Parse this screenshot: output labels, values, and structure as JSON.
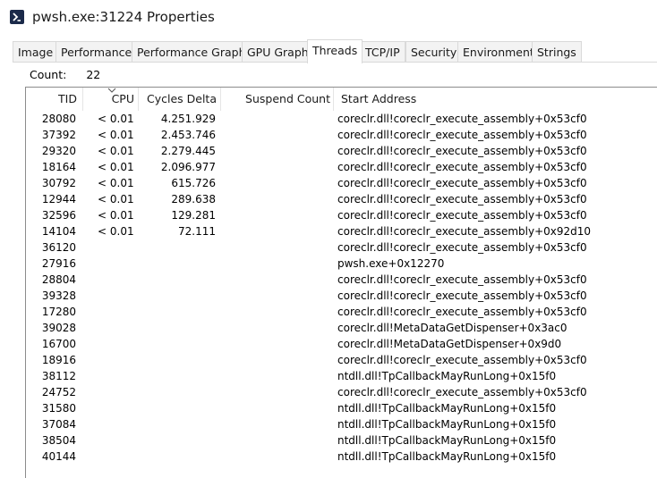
{
  "window": {
    "title": "pwsh.exe:31224 Properties",
    "icon": "powershell-icon"
  },
  "tabs": [
    {
      "label": "Image",
      "active": false
    },
    {
      "label": "Performance",
      "active": false
    },
    {
      "label": "Performance Graph",
      "active": false
    },
    {
      "label": "GPU Graph",
      "active": false
    },
    {
      "label": "Threads",
      "active": true
    },
    {
      "label": "TCP/IP",
      "active": false
    },
    {
      "label": "Security",
      "active": false
    },
    {
      "label": "Environment",
      "active": false
    },
    {
      "label": "Strings",
      "active": false
    }
  ],
  "count": {
    "label": "Count:",
    "value": "22"
  },
  "columns": {
    "tid": "TID",
    "cpu": "CPU",
    "cycles": "Cycles Delta",
    "suspend": "Suspend Count",
    "address": "Start Address"
  },
  "sort_icon": "chevron-down-icon",
  "threads": [
    {
      "tid": "28080",
      "cpu": "< 0.01",
      "cycles": "4.251.929",
      "suspend": "",
      "address": "coreclr.dll!coreclr_execute_assembly+0x53cf0"
    },
    {
      "tid": "37392",
      "cpu": "< 0.01",
      "cycles": "2.453.746",
      "suspend": "",
      "address": "coreclr.dll!coreclr_execute_assembly+0x53cf0"
    },
    {
      "tid": "29320",
      "cpu": "< 0.01",
      "cycles": "2.279.445",
      "suspend": "",
      "address": "coreclr.dll!coreclr_execute_assembly+0x53cf0"
    },
    {
      "tid": "18164",
      "cpu": "< 0.01",
      "cycles": "2.096.977",
      "suspend": "",
      "address": "coreclr.dll!coreclr_execute_assembly+0x53cf0"
    },
    {
      "tid": "30792",
      "cpu": "< 0.01",
      "cycles": "615.726",
      "suspend": "",
      "address": "coreclr.dll!coreclr_execute_assembly+0x53cf0"
    },
    {
      "tid": "12944",
      "cpu": "< 0.01",
      "cycles": "289.638",
      "suspend": "",
      "address": "coreclr.dll!coreclr_execute_assembly+0x53cf0"
    },
    {
      "tid": "32596",
      "cpu": "< 0.01",
      "cycles": "129.281",
      "suspend": "",
      "address": "coreclr.dll!coreclr_execute_assembly+0x53cf0"
    },
    {
      "tid": "14104",
      "cpu": "< 0.01",
      "cycles": "72.111",
      "suspend": "",
      "address": "coreclr.dll!coreclr_execute_assembly+0x92d10"
    },
    {
      "tid": "36120",
      "cpu": "",
      "cycles": "",
      "suspend": "",
      "address": "coreclr.dll!coreclr_execute_assembly+0x53cf0"
    },
    {
      "tid": "27916",
      "cpu": "",
      "cycles": "",
      "suspend": "",
      "address": "pwsh.exe+0x12270"
    },
    {
      "tid": "28804",
      "cpu": "",
      "cycles": "",
      "suspend": "",
      "address": "coreclr.dll!coreclr_execute_assembly+0x53cf0"
    },
    {
      "tid": "39328",
      "cpu": "",
      "cycles": "",
      "suspend": "",
      "address": "coreclr.dll!coreclr_execute_assembly+0x53cf0"
    },
    {
      "tid": "17280",
      "cpu": "",
      "cycles": "",
      "suspend": "",
      "address": "coreclr.dll!coreclr_execute_assembly+0x53cf0"
    },
    {
      "tid": "39028",
      "cpu": "",
      "cycles": "",
      "suspend": "",
      "address": "coreclr.dll!MetaDataGetDispenser+0x3ac0"
    },
    {
      "tid": "16700",
      "cpu": "",
      "cycles": "",
      "suspend": "",
      "address": "coreclr.dll!MetaDataGetDispenser+0x9d0"
    },
    {
      "tid": "18916",
      "cpu": "",
      "cycles": "",
      "suspend": "",
      "address": "coreclr.dll!coreclr_execute_assembly+0x53cf0"
    },
    {
      "tid": "38112",
      "cpu": "",
      "cycles": "",
      "suspend": "",
      "address": "ntdll.dll!TpCallbackMayRunLong+0x15f0"
    },
    {
      "tid": "24752",
      "cpu": "",
      "cycles": "",
      "suspend": "",
      "address": "coreclr.dll!coreclr_execute_assembly+0x53cf0"
    },
    {
      "tid": "31580",
      "cpu": "",
      "cycles": "",
      "suspend": "",
      "address": "ntdll.dll!TpCallbackMayRunLong+0x15f0"
    },
    {
      "tid": "37084",
      "cpu": "",
      "cycles": "",
      "suspend": "",
      "address": "ntdll.dll!TpCallbackMayRunLong+0x15f0"
    },
    {
      "tid": "38504",
      "cpu": "",
      "cycles": "",
      "suspend": "",
      "address": "ntdll.dll!TpCallbackMayRunLong+0x15f0"
    },
    {
      "tid": "40144",
      "cpu": "",
      "cycles": "",
      "suspend": "",
      "address": "ntdll.dll!TpCallbackMayRunLong+0x15f0"
    }
  ]
}
